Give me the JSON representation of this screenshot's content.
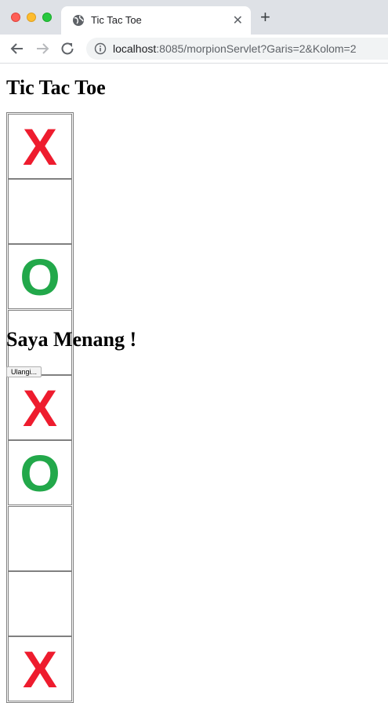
{
  "browser": {
    "tab_title": "Tic Tac Toe",
    "url_host": "localhost",
    "url_rest": ":8085/morpionServlet?Garis=2&Kolom=2"
  },
  "page": {
    "heading": "Tic Tac Toe",
    "board": [
      [
        "X",
        "",
        "O"
      ],
      [
        "",
        "X",
        "O"
      ],
      [
        "",
        "",
        "X"
      ]
    ],
    "mark_colors": {
      "X": "#ee1c2e",
      "O": "#22a84a"
    },
    "result": "Saya Menang !",
    "reset_button": "Ulangi..."
  }
}
